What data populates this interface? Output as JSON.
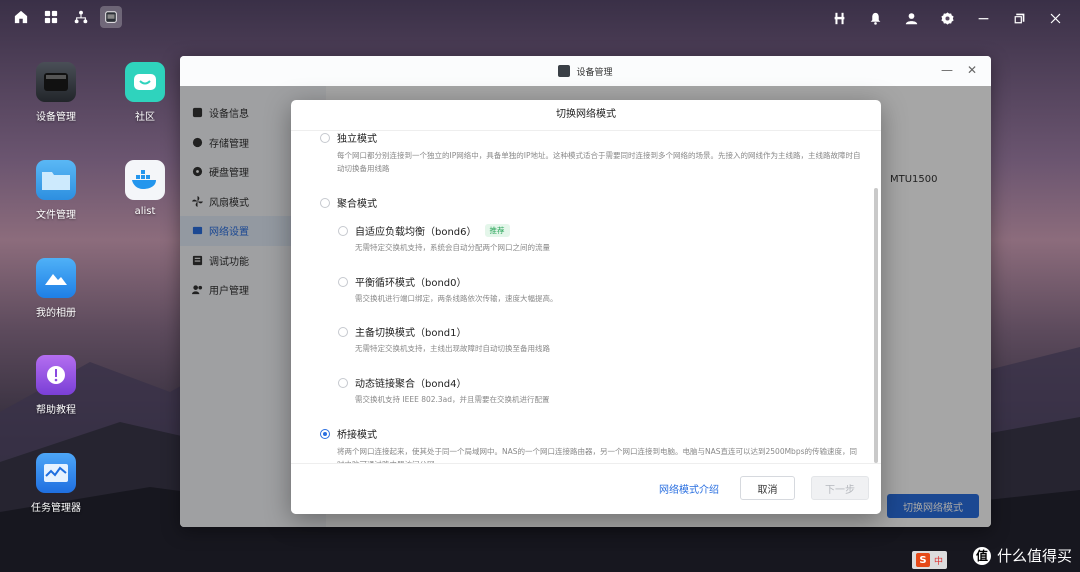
{
  "topbar": {
    "left_icons": [
      "home-icon",
      "apps-grid-icon",
      "network-icon",
      "device-manager-icon"
    ],
    "right_icons": [
      "tool-icon",
      "bell-icon",
      "user-icon",
      "settings-icon",
      "minimize-icon",
      "restore-icon",
      "close-icon"
    ]
  },
  "desktop": {
    "icons": [
      {
        "label": "设备管理"
      },
      {
        "label": "社区"
      },
      {
        "label": "文件管理"
      },
      {
        "label": "alist"
      },
      {
        "label": "我的相册"
      },
      {
        "label": "帮助教程"
      },
      {
        "label": "任务管理器"
      }
    ]
  },
  "window": {
    "title": "设备管理",
    "sidebar": [
      {
        "label": "设备信息",
        "active": false
      },
      {
        "label": "存储管理",
        "active": false
      },
      {
        "label": "硬盘管理",
        "active": false
      },
      {
        "label": "风扇模式",
        "active": false
      },
      {
        "label": "网络设置",
        "active": true
      },
      {
        "label": "调试功能",
        "active": false
      },
      {
        "label": "用户管理",
        "active": false
      }
    ],
    "mtu_text": "MTU1500",
    "switch_button": "切换网络模式"
  },
  "modal": {
    "title": "切换网络模式",
    "options": [
      {
        "label": "独立模式",
        "desc": "每个网口都分别连接到一个独立的IP网络中，具备单独的IP地址。这种模式适合于需要同时连接到多个网络的场景。先接入的网线作为主线路，主线路故障时自动切换备用线路",
        "selected": false
      },
      {
        "label": "聚合模式",
        "desc": "",
        "selected": false
      },
      {
        "label": "自适应负载均衡（bond6）",
        "tag": "推荐",
        "desc": "无需特定交换机支持，系统会自动分配两个网口之间的流量",
        "selected": false
      },
      {
        "label": "平衡循环模式（bond0）",
        "desc": "需交换机进行端口绑定，两条线路依次传输，速度大幅提高。",
        "selected": false
      },
      {
        "label": "主备切换模式（bond1）",
        "desc": "无需特定交换机支持，主线出现故障时自动切换至备用线路",
        "selected": false
      },
      {
        "label": "动态链接聚合（bond4）",
        "desc": "需交换机支持 IEEE 802.3ad，并且需要在交换机进行配置",
        "selected": false
      },
      {
        "label": "桥接模式",
        "desc": "将两个网口连接起来，使其处于同一个局域网中。NAS的一个网口连接路由器，另一个网口连接到电脑。电脑与NAS直连可以达到2500Mbps的传输速度，同时电脑可通过路由器访问公网",
        "selected": true
      }
    ],
    "footer": {
      "link": "网络模式介绍",
      "cancel": "取消",
      "next": "下一步"
    }
  },
  "watermark": "什么值得买",
  "watermark_logo": "值",
  "ime": {
    "logo": "S",
    "chars": "中"
  }
}
